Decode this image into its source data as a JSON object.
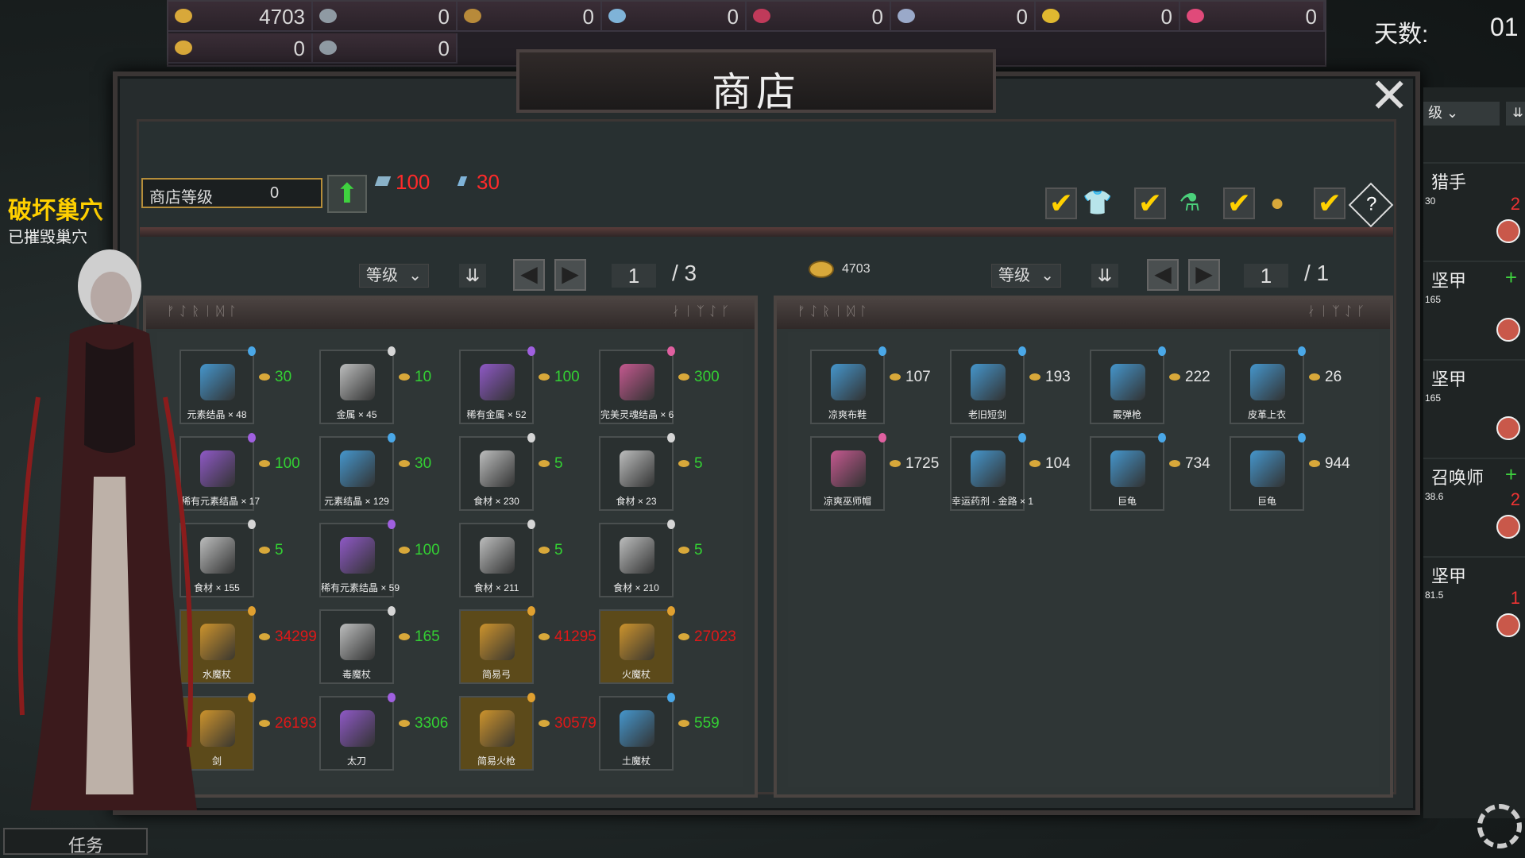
{
  "resources": {
    "row1": [
      {
        "icon": "gold-coin-icon",
        "value": "4703"
      },
      {
        "icon": "metal-ingot-icon",
        "value": "0"
      },
      {
        "icon": "rare-metal-icon",
        "value": "0"
      },
      {
        "icon": "element-crystal-icon",
        "value": "0"
      },
      {
        "icon": "rare-crystal-icon",
        "value": "0"
      },
      {
        "icon": "ring-icon",
        "value": "0"
      },
      {
        "icon": "soul-crystal-icon",
        "value": "0"
      },
      {
        "icon": "red-gem-icon",
        "value": "0"
      }
    ],
    "row2": [
      {
        "icon": "food-icon",
        "value": "0"
      },
      {
        "icon": "red-ore-icon",
        "value": "0"
      }
    ]
  },
  "days": {
    "label": "天数:",
    "value": "01"
  },
  "shop": {
    "title": "商店",
    "level_label": "商店等级",
    "level_value": "0",
    "upgrade_cost_metal": "100",
    "upgrade_cost_crystal": "30",
    "gold": "4703",
    "left": {
      "sort_label": "等级",
      "page": "1",
      "total": "/ 3"
    },
    "right": {
      "sort_label": "等级",
      "page": "1",
      "total": "/ 1"
    }
  },
  "quest": {
    "title": "破坏巢穴",
    "subtitle": "已摧毁巢穴"
  },
  "task_button": "任务",
  "sidebar": {
    "sort_label": "级",
    "cards": [
      {
        "name": "猎手",
        "level": "30",
        "count": "2",
        "plus": ""
      },
      {
        "name": "坚甲",
        "level": "165",
        "count": "",
        "plus": "+"
      },
      {
        "name": "坚甲",
        "level": "165",
        "count": "",
        "plus": ""
      },
      {
        "name": "召唤师",
        "level": "38.6",
        "count": "2",
        "plus": "+"
      },
      {
        "name": "坚甲",
        "level": "81.5",
        "count": "1",
        "plus": ""
      }
    ]
  },
  "left_items": [
    {
      "name": "元素结晶 × 48",
      "price": "30",
      "price_color": "green",
      "rarity": "blue"
    },
    {
      "name": "金属 × 45",
      "price": "10",
      "price_color": "green",
      "rarity": "white"
    },
    {
      "name": "稀有金属 × 52",
      "price": "100",
      "price_color": "green",
      "rarity": "purple"
    },
    {
      "name": "完美灵魂结晶 × 6",
      "price": "300",
      "price_color": "green",
      "rarity": "pink"
    },
    {
      "name": "稀有元素结晶 × 17",
      "price": "100",
      "price_color": "green",
      "rarity": "purple"
    },
    {
      "name": "元素结晶 × 129",
      "price": "30",
      "price_color": "green",
      "rarity": "blue"
    },
    {
      "name": "食材 × 230",
      "price": "5",
      "price_color": "green",
      "rarity": "white"
    },
    {
      "name": "食材 × 23",
      "price": "5",
      "price_color": "green",
      "rarity": "white"
    },
    {
      "name": "食材 × 155",
      "price": "5",
      "price_color": "green",
      "rarity": "white"
    },
    {
      "name": "稀有元素结晶 × 59",
      "price": "100",
      "price_color": "green",
      "rarity": "purple"
    },
    {
      "name": "食材 × 211",
      "price": "5",
      "price_color": "green",
      "rarity": "white"
    },
    {
      "name": "食材 × 210",
      "price": "5",
      "price_color": "green",
      "rarity": "white"
    },
    {
      "name": "水魔杖",
      "price": "34299",
      "price_color": "red",
      "rarity": "gold"
    },
    {
      "name": "毒魔杖",
      "price": "165",
      "price_color": "green",
      "rarity": "white"
    },
    {
      "name": "简易弓",
      "price": "41295",
      "price_color": "red",
      "rarity": "gold"
    },
    {
      "name": "火魔杖",
      "price": "27023",
      "price_color": "red",
      "rarity": "gold"
    },
    {
      "name": "剑",
      "price": "26193",
      "price_color": "red",
      "rarity": "gold"
    },
    {
      "name": "太刀",
      "price": "3306",
      "price_color": "green",
      "rarity": "purple"
    },
    {
      "name": "简易火枪",
      "price": "30579",
      "price_color": "red",
      "rarity": "gold"
    },
    {
      "name": "土魔杖",
      "price": "559",
      "price_color": "green",
      "rarity": "blue"
    }
  ],
  "right_items": [
    {
      "name": "凉爽布鞋",
      "price": "107",
      "price_color": "white",
      "rarity": "blue"
    },
    {
      "name": "老旧短剑",
      "price": "193",
      "price_color": "white",
      "rarity": "blue"
    },
    {
      "name": "霰弹枪",
      "price": "222",
      "price_color": "white",
      "rarity": "blue"
    },
    {
      "name": "皮革上衣",
      "price": "26",
      "price_color": "white",
      "rarity": "blue"
    },
    {
      "name": "凉爽巫师帽",
      "price": "1725",
      "price_color": "white",
      "rarity": "pink"
    },
    {
      "name": "幸运药剂 - 金路 × 1",
      "price": "104",
      "price_color": "white",
      "rarity": "blue"
    },
    {
      "name": "巨龟",
      "price": "734",
      "price_color": "white",
      "rarity": "blue"
    },
    {
      "name": "巨龟",
      "price": "944",
      "price_color": "white",
      "rarity": "blue"
    }
  ],
  "colors": {
    "accent_gold": "#d8a83a",
    "price_green": "#33d133",
    "price_red": "#e01818"
  }
}
